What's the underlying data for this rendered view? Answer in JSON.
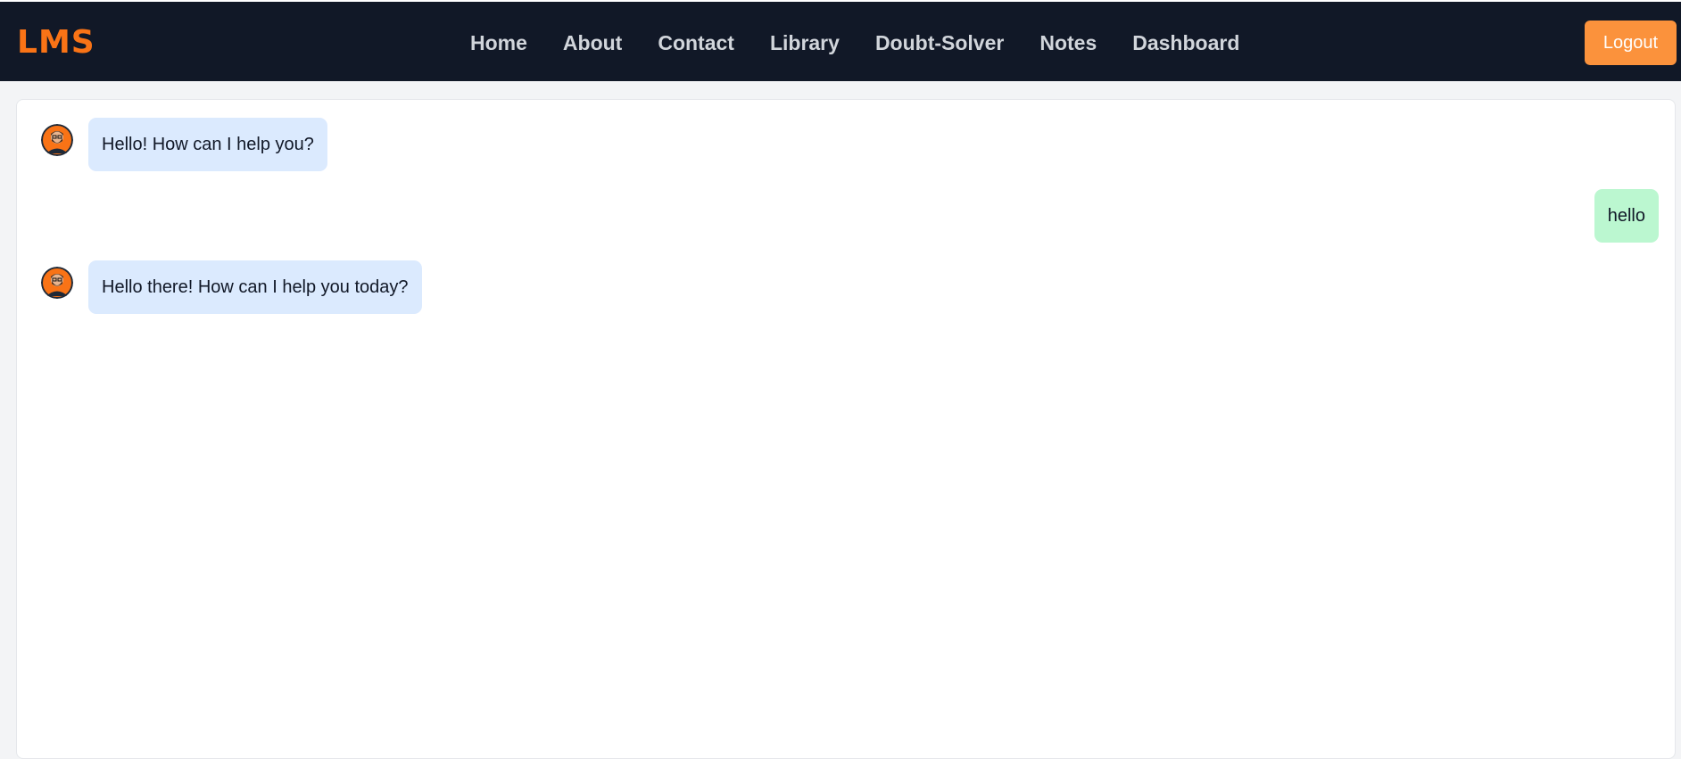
{
  "header": {
    "logo": "LMS",
    "nav": [
      {
        "label": "Home"
      },
      {
        "label": "About"
      },
      {
        "label": "Contact"
      },
      {
        "label": "Library"
      },
      {
        "label": "Doubt-Solver"
      },
      {
        "label": "Notes"
      },
      {
        "label": "Dashboard"
      }
    ],
    "logout_label": "Logout"
  },
  "chat": {
    "messages": [
      {
        "sender": "bot",
        "text": "Hello! How can I help you?"
      },
      {
        "sender": "user",
        "text": "hello"
      },
      {
        "sender": "bot",
        "text": "Hello there! How can I help you today?"
      }
    ]
  },
  "colors": {
    "nav_bg": "#111827",
    "accent": "#f97316",
    "logout_bg": "#fb923c",
    "bot_bubble": "#dbeafe",
    "user_bubble": "#bbf7d0"
  }
}
